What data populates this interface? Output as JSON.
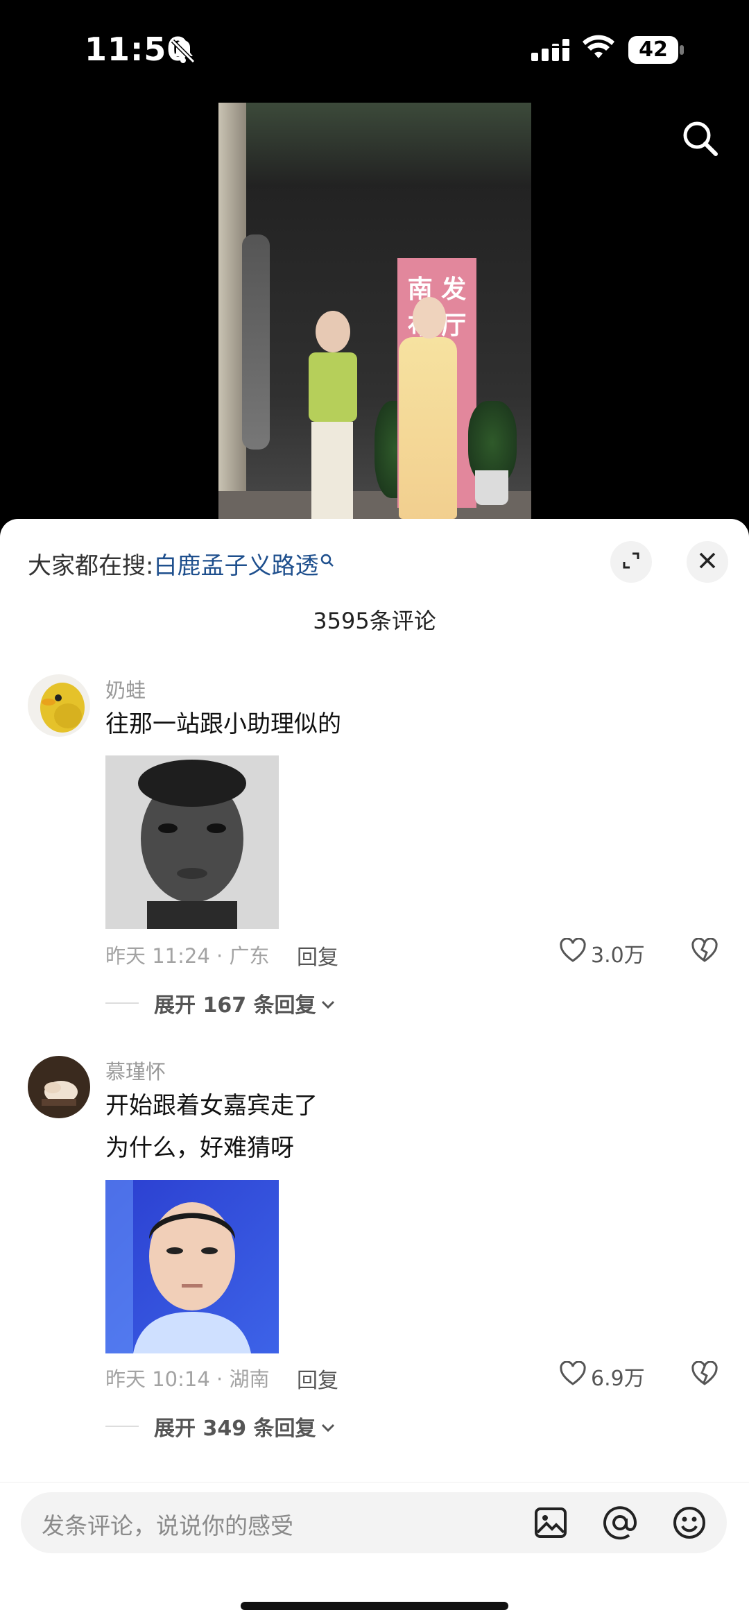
{
  "status_bar": {
    "time": "11:50",
    "battery": "42"
  },
  "trending": {
    "prefix": "大家都在搜:",
    "keyword": "白鹿孟子义路透"
  },
  "comments_header": {
    "count_label": "3595条评论"
  },
  "comments": [
    {
      "username": "奶蛙",
      "text_lines": [
        "往那一站跟小助理似的"
      ],
      "meta": "昨天 11:24 · 广东",
      "reply_label": "回复",
      "likes": "3.0万",
      "expand_label": "展开 167 条回复"
    },
    {
      "username": "慕瑾怀",
      "text_lines": [
        "开始跟着女嘉宾走了",
        "为什么，好难猜呀"
      ],
      "meta": "昨天 10:14 · 湖南",
      "reply_label": "回复",
      "likes": "6.9万",
      "expand_label": "展开 349 条回复"
    }
  ],
  "video": {
    "banner_text": "南 发 布 厅"
  },
  "composer": {
    "placeholder": "发条评论，说说你的感受"
  },
  "colors": {
    "keyword": "#1e4f8d",
    "sheet": "#ffffff",
    "background": "#000000"
  },
  "icons": [
    "bell-muted-icon",
    "signal-icon",
    "wifi-icon",
    "search-icon",
    "expand-icon",
    "close-icon",
    "heart-icon",
    "broken-heart-icon",
    "chevron-down-icon",
    "image-icon",
    "at-icon",
    "emoji-icon"
  ]
}
